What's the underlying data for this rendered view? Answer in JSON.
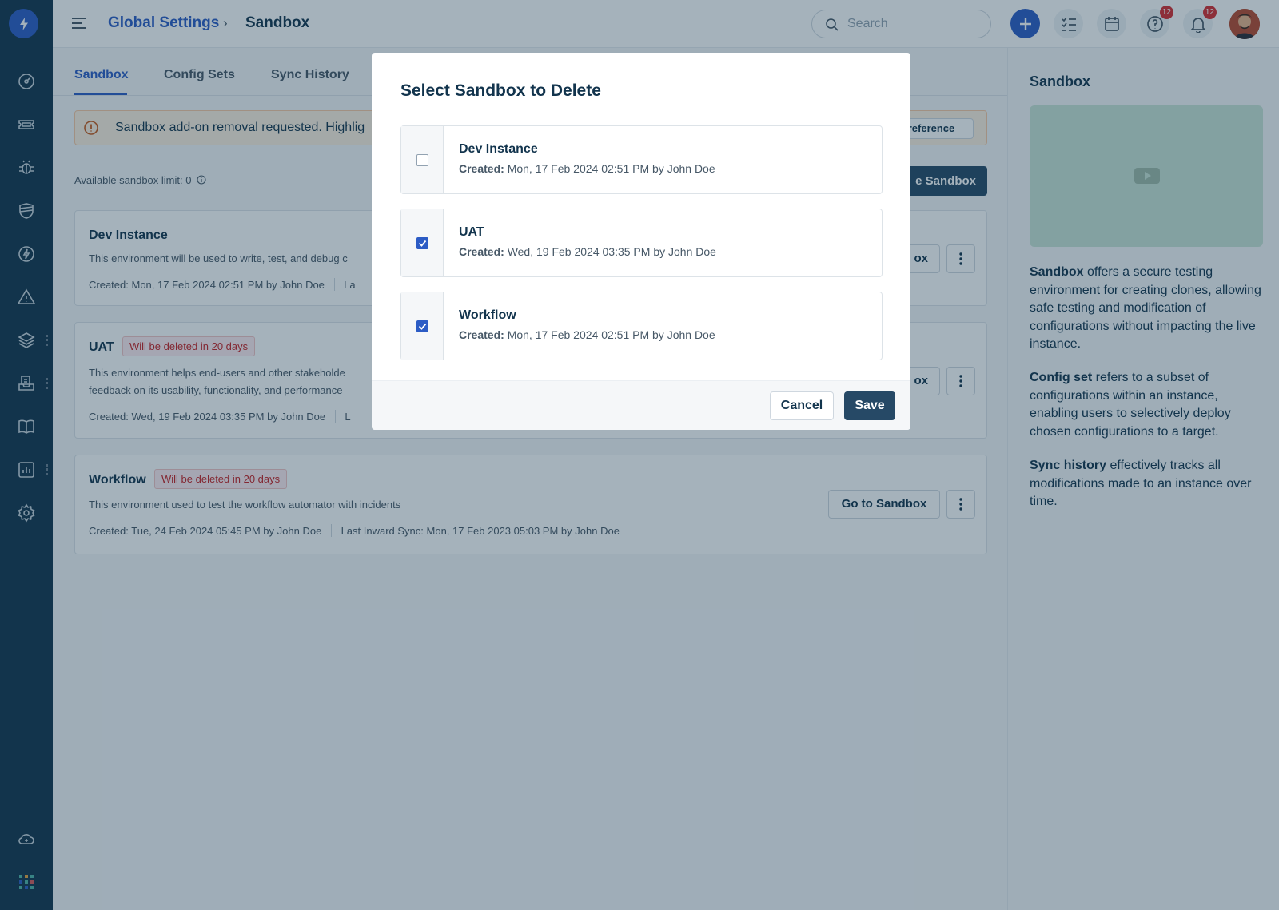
{
  "topbar": {
    "breadcrumb_root": "Global Settings",
    "breadcrumb_sep": "›",
    "breadcrumb_leaf": "Sandbox",
    "search_placeholder": "Search",
    "help_badge": "12",
    "notification_badge": "12"
  },
  "tabs": [
    {
      "label": "Sandbox",
      "active": true
    },
    {
      "label": "Config Sets",
      "active": false
    },
    {
      "label": "Sync History",
      "active": false
    }
  ],
  "banner": {
    "text": "Sandbox add-on removal requested. Highlig",
    "button_label": "reference"
  },
  "limit": {
    "text": "Available sandbox limit: 0"
  },
  "create_button": {
    "label": "e Sandbox"
  },
  "cards": [
    {
      "title": "Dev Instance",
      "tag": "",
      "description": "This environment will be used to write, test, and debug c",
      "created_label": "Created:",
      "created_value": "Mon, 17 Feb 2024 02:51 PM",
      "by_label": "by",
      "by_value": "John Doe",
      "sync_label": "La",
      "sync_value": "",
      "go_label": "ox"
    },
    {
      "title": "UAT",
      "tag": "Will be deleted in 20 days",
      "description": "This environment helps end-users and other stakeholde feedback on its usability, functionality, and performance",
      "created_label": "Created:",
      "created_value": "Wed, 19 Feb 2024 03:35 PM",
      "by_label": "by",
      "by_value": "John Doe",
      "sync_label": "L",
      "sync_value": "",
      "go_label": "ox"
    },
    {
      "title": "Workflow",
      "tag": "Will be deleted in 20 days",
      "description": "This environment used to test the workflow automator with incidents",
      "created_label": "Created:",
      "created_value": "Tue, 24 Feb 2024 05:45 PM",
      "by_label": "by",
      "by_value": "John Doe",
      "sync_label": "Last Inward Sync:",
      "sync_value": "Mon, 17 Feb 2023 05:03 PM",
      "sync_by_label": "by",
      "sync_by_value": "John Doe",
      "go_label": "Go to Sandbox"
    }
  ],
  "side_panel": {
    "heading": "Sandbox",
    "p1_bold": "Sandbox",
    "p1_rest": " offers a secure testing environment for creating clones, allowing safe testing and modification of configurations without impacting the live instance.",
    "p2_bold": "Config set",
    "p2_rest": " refers to a subset of configurations within an instance, enabling users to selectively deploy chosen configurations to a target.",
    "p3_bold": "Sync history",
    "p3_rest": " effectively tracks all modifications made to an instance over time."
  },
  "modal": {
    "title": "Select Sandbox to Delete",
    "options": [
      {
        "name": "Dev Instance",
        "created_label": "Created:",
        "created_value": "Mon, 17 Feb 2024 02:51 PM by John Doe",
        "checked": false
      },
      {
        "name": "UAT",
        "created_label": "Created:",
        "created_value": "Wed, 19 Feb 2024 03:35 PM by John Doe",
        "checked": true
      },
      {
        "name": "Workflow",
        "created_label": "Created:",
        "created_value": "Mon, 17 Feb 2024 02:51 PM by John Doe",
        "checked": true
      }
    ],
    "cancel_label": "Cancel",
    "save_label": "Save"
  },
  "colors": {
    "rail": "#12344d",
    "accent": "#2c5cc5",
    "primary_button": "#264966",
    "danger": "#c82124",
    "warning_bg": "#fef1e1"
  }
}
